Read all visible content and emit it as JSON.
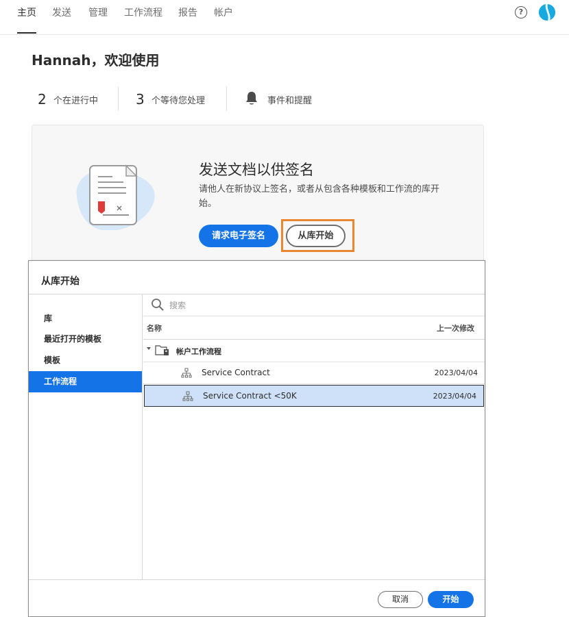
{
  "nav": {
    "items": [
      {
        "label": "主页",
        "active": true
      },
      {
        "label": "发送"
      },
      {
        "label": "管理"
      },
      {
        "label": "工作流程"
      },
      {
        "label": "报告"
      },
      {
        "label": "帐户"
      }
    ],
    "help_icon": "question-circle-icon",
    "avatar_icon": "user-avatar"
  },
  "welcome": {
    "title": "Hannah，欢迎使用"
  },
  "stats": {
    "in_progress_count": "2",
    "in_progress_label": "个在进行中",
    "waiting_count": "3",
    "waiting_label": "个等待您处理",
    "events_label": "事件和提醒",
    "events_icon": "bell-icon"
  },
  "send_card": {
    "title": "发送文档以供签名",
    "description": "请他人在新协议上签名，或者从包含各种模板和工作流的库开始。",
    "request_button": "请求电子签名",
    "library_button": "从库开始",
    "highlight_color": "#e8872f"
  },
  "modal": {
    "title": "从库开始",
    "sidebar": [
      {
        "label": "库"
      },
      {
        "label": "最近打开的模板"
      },
      {
        "label": "模板"
      },
      {
        "label": "工作流程",
        "selected": true
      }
    ],
    "search_placeholder": "搜索",
    "columns": {
      "name": "名称",
      "modified": "上一次修改"
    },
    "folder": {
      "label": "帐户工作流程",
      "icon": "folder-icon"
    },
    "rows": [
      {
        "name": "Service Contract",
        "date": "2023/04/04",
        "icon": "workflow-icon"
      },
      {
        "name": "Service Contract <50K",
        "date": "2023/04/04",
        "icon": "workflow-icon",
        "selected": true
      }
    ],
    "cancel_button": "取消",
    "start_button": "开始"
  },
  "colors": {
    "primary": "#1473e6",
    "selected_row": "#cfe1f8",
    "avatar": "#17a9e0"
  }
}
